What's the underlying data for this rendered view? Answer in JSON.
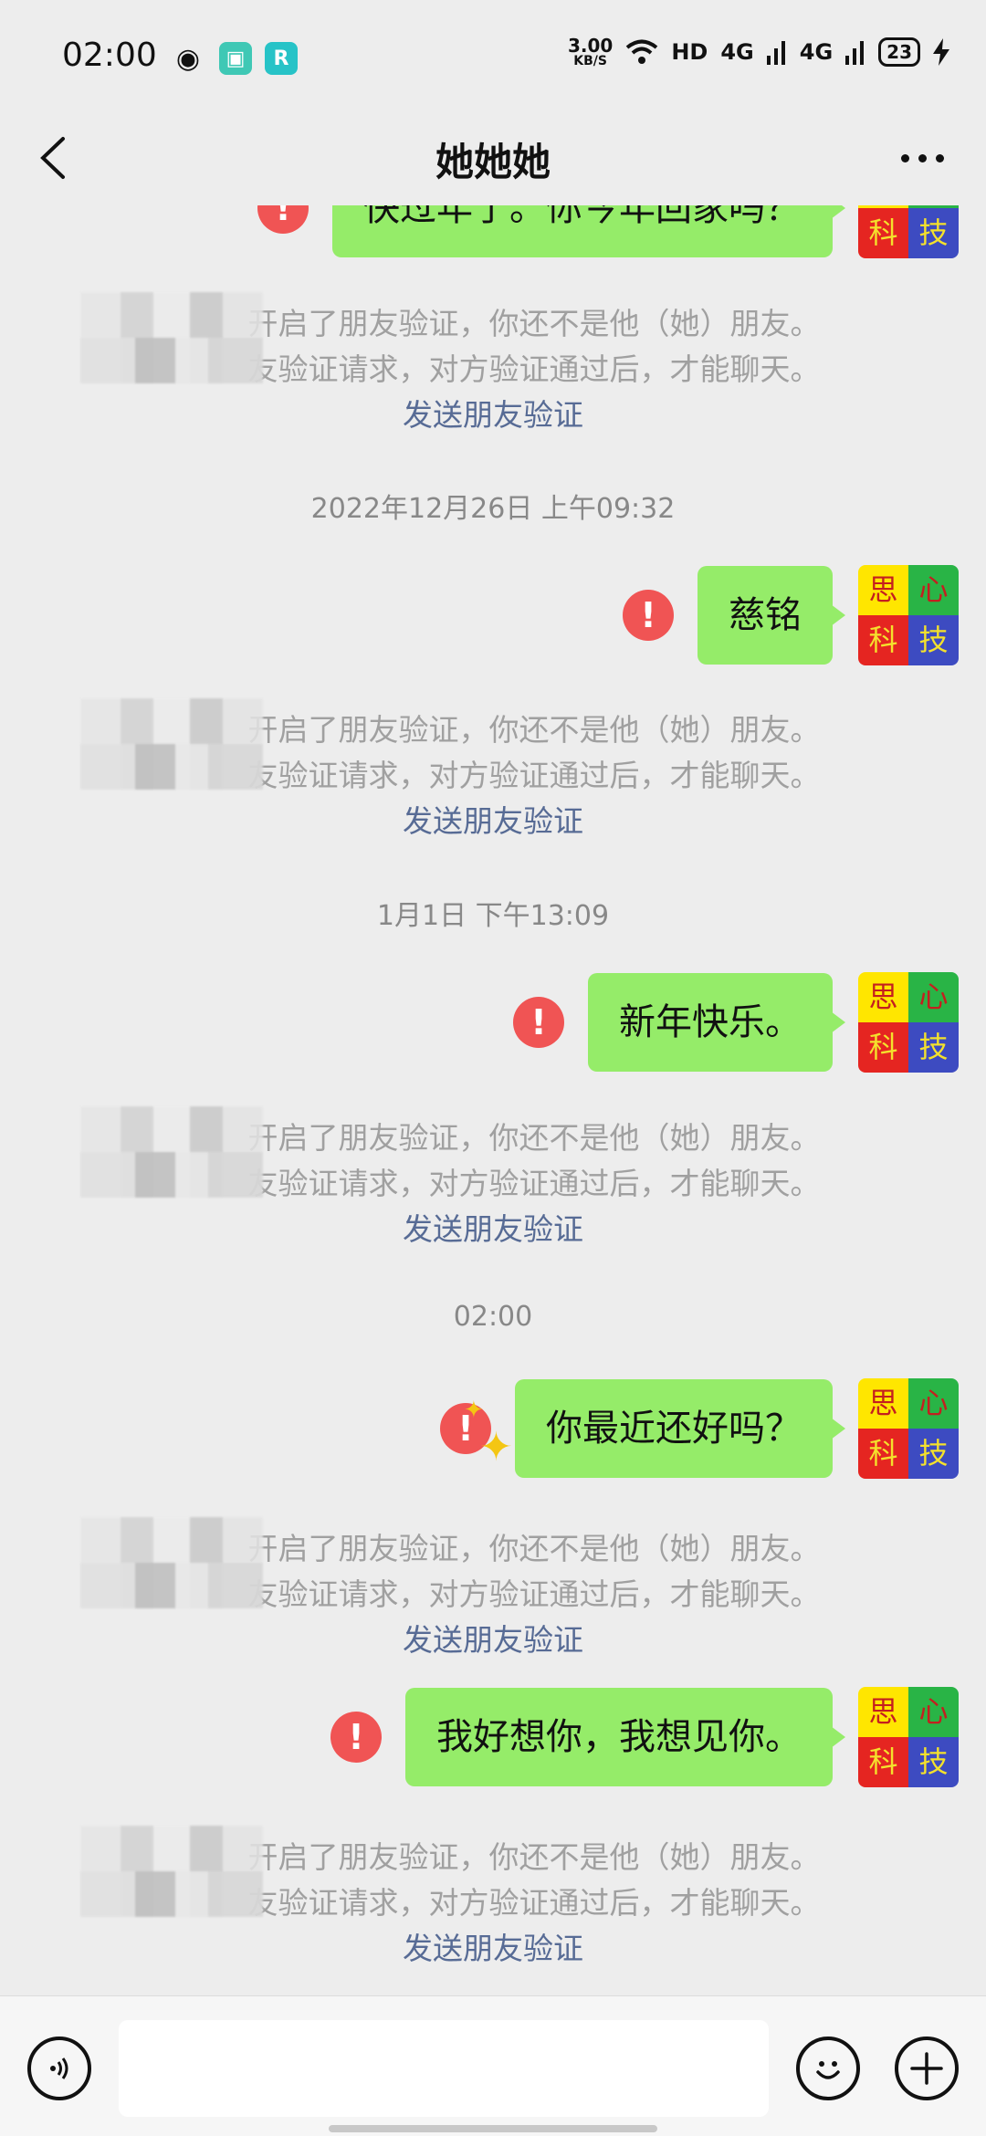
{
  "status_bar": {
    "time": "02:00",
    "net_speed_value": "3.00",
    "net_speed_unit": "KB/S",
    "hd_label": "HD",
    "signal1": "4G",
    "signal2": "4G",
    "battery": "23",
    "icons": [
      "wechat-icon",
      "app-icon-teal",
      "app-icon-cyan",
      "wifi-icon",
      "charging-icon"
    ]
  },
  "header": {
    "title": "她她她",
    "back_icon": "chevron-left-icon",
    "more_icon": "more-dots-icon"
  },
  "avatar": {
    "chars": [
      "思",
      "心",
      "科",
      "技"
    ]
  },
  "messages": [
    {
      "text": "快过年了。你今年回家吗？",
      "status": "failed"
    },
    {
      "text": "慈铭",
      "status": "failed"
    },
    {
      "text": "新年快乐。",
      "status": "failed"
    },
    {
      "text": "你最近还好吗？",
      "status": "failed"
    },
    {
      "text": "我好想你，我想见你。",
      "status": "failed"
    }
  ],
  "timestamps": [
    "2022年12月26日 上午09:32",
    "1月1日 下午13:09",
    "02:00"
  ],
  "system_notice": {
    "line1": "开启了朋友验证，你还不是他（她）朋友。",
    "line2": "友验证请求，对方验证通过后，才能聊天。",
    "link": "发送朋友验证"
  },
  "input_bar": {
    "placeholder": "",
    "voice_icon": "voice-icon",
    "emoji_icon": "emoji-icon",
    "plus_icon": "plus-icon"
  },
  "colors": {
    "bubble": "#95ec69",
    "error": "#f05454",
    "link": "#576b95",
    "background": "#ededed"
  }
}
